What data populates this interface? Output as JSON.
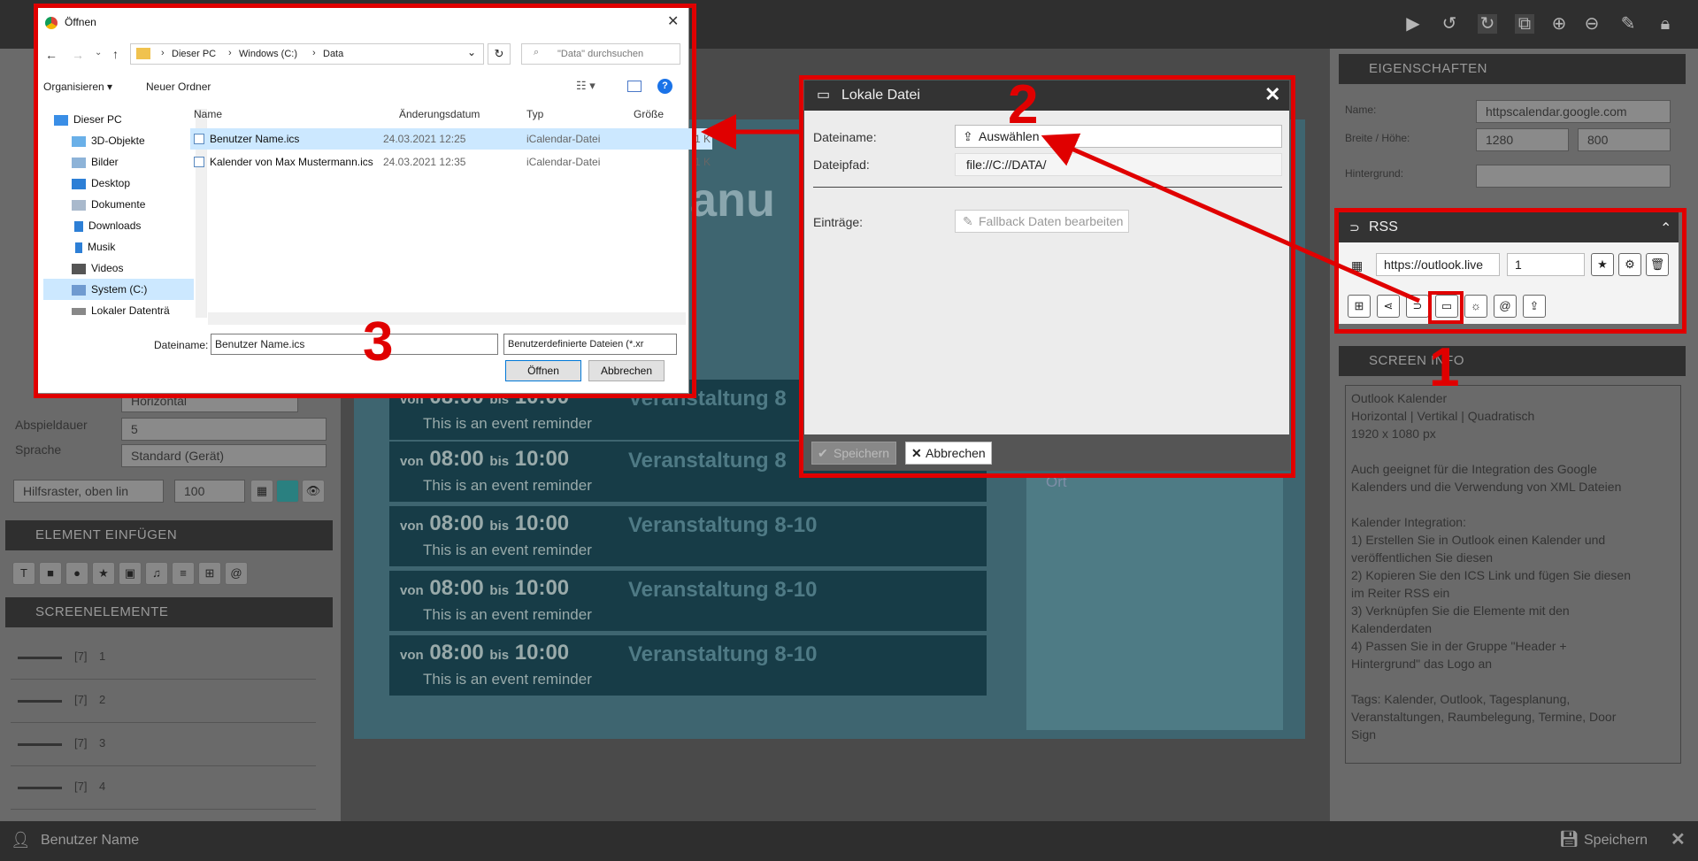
{
  "footer": {
    "user": "Benutzer Name",
    "save": "Speichern"
  },
  "left": {
    "rows": [
      {
        "label": "Abspieldauer",
        "value": "5"
      },
      {
        "label": "Sprache",
        "value": "Standard (Gerät)"
      }
    ],
    "orientation": "Horizontal",
    "grid": {
      "select": "Hilfsraster, oben lin",
      "value": "100"
    },
    "insert_title": "ELEMENT EINFÜGEN",
    "elements_title": "SCREENELEMENTE",
    "elements": [
      {
        "tag": "[7]",
        "idx": "1"
      },
      {
        "tag": "[7]",
        "idx": "2"
      },
      {
        "tag": "[7]",
        "idx": "3"
      },
      {
        "tag": "[7]",
        "idx": "4"
      }
    ]
  },
  "canvas": {
    "title_frag": "anu",
    "events": [
      {
        "from": "von",
        "t1": "08:00",
        "to": "bis",
        "t2": "10:00",
        "name": "Veranstaltung 8",
        "sub": "This is an event reminder"
      },
      {
        "from": "von",
        "t1": "08:00",
        "to": "bis",
        "t2": "10:00",
        "name": "Veranstaltung 8",
        "sub": "This is an event reminder"
      },
      {
        "from": "von",
        "t1": "08:00",
        "to": "bis",
        "t2": "10:00",
        "name": "Veranstaltung 8-10",
        "sub": "This is an event reminder"
      },
      {
        "from": "von",
        "t1": "08:00",
        "to": "bis",
        "t2": "10:00",
        "name": "Veranstaltung 8-10",
        "sub": "This is an event reminder"
      },
      {
        "from": "von",
        "t1": "08:00",
        "to": "bis",
        "t2": "10:00",
        "name": "Veranstaltung 8-10",
        "sub": "This is an event reminder"
      }
    ],
    "side": "Ort"
  },
  "props": {
    "title": "EIGENSCHAFTEN",
    "name_label": "Name:",
    "name_value": "httpscalendar.google.com",
    "size_label": "Breite / Höhe:",
    "width": "1280",
    "height": "800",
    "bg_label": "Hintergrund:"
  },
  "rss": {
    "title": "RSS",
    "url": "https://outlook.live",
    "count": "1"
  },
  "info": {
    "title": "SCREEN INFO",
    "lines": [
      "Outlook Kalender",
      "Horizontal | Vertikal | Quadratisch",
      "1920 x 1080 px",
      "",
      "Auch geeignet für die Integration des Google",
      "Kalenders und die Verwendung von XML Dateien",
      "",
      "Kalender Integration:",
      "1) Erstellen Sie in Outlook einen Kalender und",
      "veröffentlichen Sie diesen",
      "2) Kopieren Sie den ICS Link und fügen Sie diesen",
      "im Reiter RSS ein",
      "3) Verknüpfen Sie die Elemente mit den",
      "Kalenderdaten",
      "4) Passen Sie in der Gruppe \"Header +",
      "Hintergrund\" das Logo an",
      "",
      "Tags: Kalender, Outlook, Tagesplanung,",
      "Veranstaltungen, Raumbelegung, Termine, Door",
      "Sign"
    ]
  },
  "localfile": {
    "title": "Lokale Datei",
    "filename_label": "Dateiname:",
    "choose_label": "Auswählen",
    "path_label": "Dateipfad:",
    "path_value": "file://C://DATA/",
    "entries_label": "Einträge:",
    "fallback_label": "Fallback Daten bearbeiten",
    "save_label": "Speichern",
    "cancel_label": "Abbrechen"
  },
  "filedialog": {
    "title": "Öffnen",
    "breadcrumb": [
      "Dieser PC",
      "Windows (C:)",
      "Data"
    ],
    "search_placeholder": "\"Data\" durchsuchen",
    "organize": "Organisieren",
    "new_folder": "Neuer Ordner",
    "nav": [
      "Dieser PC",
      "3D-Objekte",
      "Bilder",
      "Desktop",
      "Dokumente",
      "Downloads",
      "Musik",
      "Videos",
      "System (C:)",
      "Lokaler Datenträ"
    ],
    "columns": {
      "name": "Name",
      "date": "Änderungsdatum",
      "type": "Typ",
      "size": "Größe"
    },
    "files": [
      {
        "name": "Benutzer Name.ics",
        "date": "24.03.2021 12:25",
        "type": "iCalendar-Datei",
        "size": "1 K"
      },
      {
        "name": "Kalender von Max Mustermann.ics",
        "date": "24.03.2021 12:35",
        "type": "iCalendar-Datei",
        "size": "1 K"
      }
    ],
    "filename_label": "Dateiname:",
    "filename_value": "Benutzer Name.ics",
    "filetype_value": "Benutzerdefinierte Dateien (*.xr",
    "open_label": "Öffnen",
    "cancel_label": "Abbrechen"
  },
  "annotations": {
    "n1": "1",
    "n2": "2",
    "n3": "3"
  },
  "colors": {
    "annotation_red": "#e00000",
    "canvas_bg": "#3e6570",
    "event_bg": "#173c47"
  }
}
